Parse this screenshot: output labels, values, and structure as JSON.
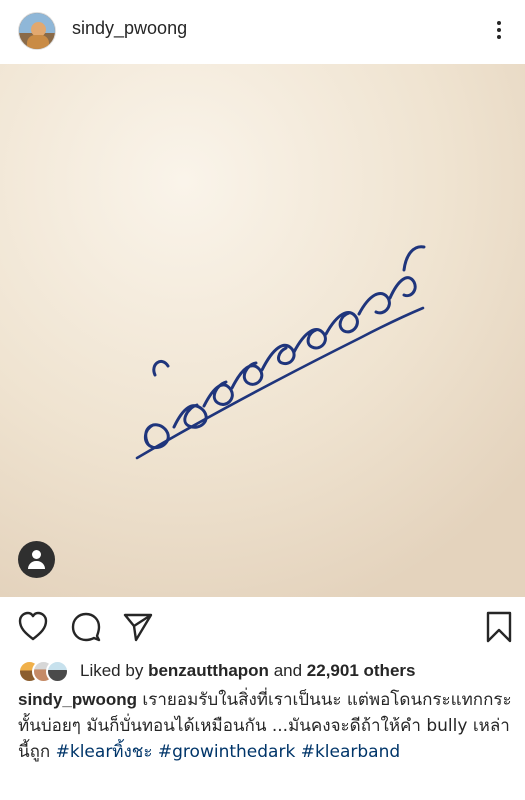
{
  "post": {
    "username": "sindy_pwoong",
    "image": {
      "alt_text": "handwritten Thai text crossed out on paper",
      "ink_color": "#1f357c",
      "paper_color": "#f4ead9"
    },
    "likes": {
      "prefix": "Liked by",
      "liker": "benzautthapon",
      "connector": "and",
      "count": "22,901 others"
    },
    "caption": {
      "username": "sindy_pwoong",
      "text": "เรายอมรับในสิ่งที่เราเป็นนะ แต่พอโดนกระแทกกระทั้นบ่อยๆ มันก็บั่นทอนได้เหมือนกัน ...มันคงจะดีถ้าให้คำ bully เหล่านี้ถูก",
      "hashtags": [
        "#klearทิ้งชะ",
        "#growinthedark",
        "#klearband"
      ]
    }
  },
  "icons": {
    "more": "more-icon",
    "tag": "user-tag-icon",
    "like": "heart-icon",
    "comment": "comment-icon",
    "share": "send-icon",
    "save": "bookmark-icon"
  }
}
